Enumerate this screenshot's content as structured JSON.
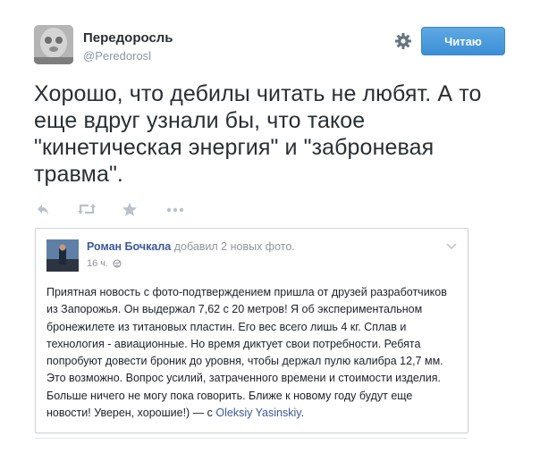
{
  "tweet": {
    "author_name": "Передоросль",
    "author_handle": "@Peredorosl",
    "follow_label": "Читаю",
    "text": "Хорошо, что дебилы читать не любят. А то еще вдруг узнали бы, что такое \"кинетическая энергия\" и \"заброневая травма\"."
  },
  "icons": {
    "gear": "gear-icon",
    "reply": "reply-icon",
    "retweet": "retweet-icon",
    "favorite": "star-icon",
    "more": "more-icon"
  },
  "embed": {
    "author": "Роман Бочкала",
    "added_text": "добавил 2 новых фото.",
    "time": "16 ч.",
    "body": "Приятная новость с фото-подтверждением пришла от друзей разработчиков из Запорожья. Он выдержал 7,62 с 20 метров! Я об экспериментальном бронежилете из титановых пластин. Его вес всего лишь 4 кг. Сплав и технология - авиационные. Но время диктует свои потребности. Ребята попробуют довести броник до уровня, чтобы держал пулю калибра 12,7 мм. Это возможно. Вопрос усилий, затраченного времени и стоимости изделия. Больше ничего не могу пока говорить. Ближе к новому году будут еще новости! Уверен, хорошие!) — с ",
    "tagged": "Oleksiy Yasinskiy",
    "trailing": "."
  },
  "colors": {
    "button_blue": "#3b8fd6",
    "fb_link": "#3b5998",
    "muted": "#8899a6"
  }
}
